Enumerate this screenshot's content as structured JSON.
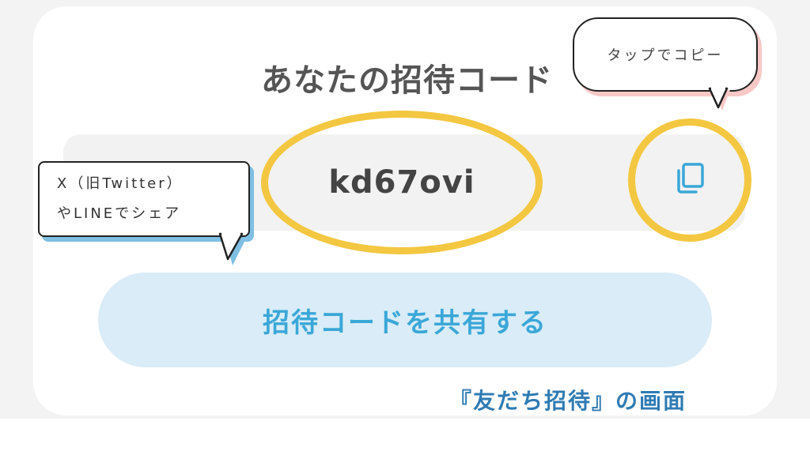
{
  "title": "あなたの招待コード",
  "invite_code": "kd67ovi",
  "copy_icon": "copy-icon",
  "share_button_label": "招待コードを共有する",
  "callout_copy": "タップでコピー",
  "callout_share": {
    "line1": "X（旧Twitter）",
    "line2": "やLINEでシェア"
  },
  "caption": "『友だち招待』の画面",
  "colors": {
    "highlight_ring": "#f3c741",
    "share_button_bg": "#d9ecf7",
    "share_button_text": "#3aa7d8",
    "caption": "#2f7bb4"
  }
}
